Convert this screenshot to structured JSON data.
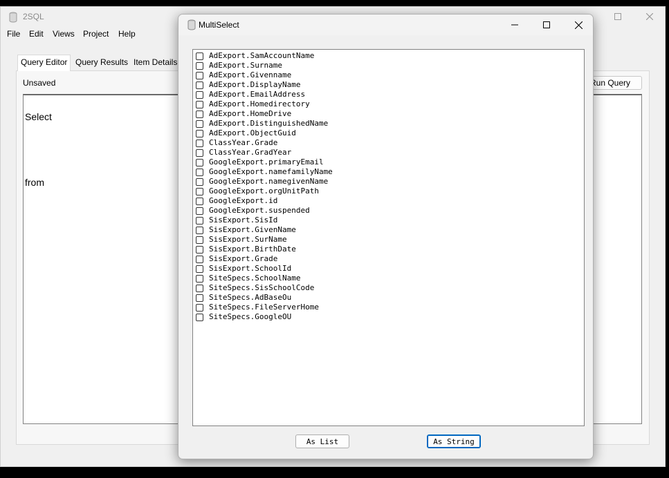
{
  "main_window": {
    "title": "2SQL",
    "app_icon": "database-stack-icon",
    "menu": [
      "File",
      "Edit",
      "Views",
      "Project",
      "Help"
    ],
    "tabs": [
      "Query Editor",
      "Query Results",
      "Item Details"
    ],
    "status_label": "Unsaved",
    "run_button_label": "Run Query",
    "query_lines": [
      "Select",
      "from"
    ]
  },
  "dialog": {
    "title": "MultiSelect",
    "app_icon": "database-stack-icon",
    "fields": [
      {
        "label": "AdExport.SamAccountName",
        "checked": false
      },
      {
        "label": "AdExport.Surname",
        "checked": false
      },
      {
        "label": "AdExport.Givenname",
        "checked": false
      },
      {
        "label": "AdExport.DisplayName",
        "checked": false
      },
      {
        "label": "AdExport.EmailAddress",
        "checked": false
      },
      {
        "label": "AdExport.Homedirectory",
        "checked": false
      },
      {
        "label": "AdExport.HomeDrive",
        "checked": false
      },
      {
        "label": "AdExport.DistinguishedName",
        "checked": false
      },
      {
        "label": "AdExport.ObjectGuid",
        "checked": false
      },
      {
        "label": "ClassYear.Grade",
        "checked": false
      },
      {
        "label": "ClassYear.GradYear",
        "checked": false
      },
      {
        "label": "GoogleExport.primaryEmail",
        "checked": false
      },
      {
        "label": "GoogleExport.namefamilyName",
        "checked": false
      },
      {
        "label": "GoogleExport.namegivenName",
        "checked": false
      },
      {
        "label": "GoogleExport.orgUnitPath",
        "checked": false
      },
      {
        "label": "GoogleExport.id",
        "checked": false
      },
      {
        "label": "GoogleExport.suspended",
        "checked": false
      },
      {
        "label": "SisExport.SisId",
        "checked": false
      },
      {
        "label": "SisExport.GivenName",
        "checked": false
      },
      {
        "label": "SisExport.SurName",
        "checked": false
      },
      {
        "label": "SisExport.BirthDate",
        "checked": false
      },
      {
        "label": "SisExport.Grade",
        "checked": false
      },
      {
        "label": "SisExport.SchoolId",
        "checked": false
      },
      {
        "label": "SiteSpecs.SchoolName",
        "checked": false
      },
      {
        "label": "SiteSpecs.SisSchoolCode",
        "checked": false
      },
      {
        "label": "SiteSpecs.AdBaseOu",
        "checked": false
      },
      {
        "label": "SiteSpecs.FileServerHome",
        "checked": false
      },
      {
        "label": "SiteSpecs.GoogleOU",
        "checked": false
      }
    ],
    "buttons": {
      "as_list": "As List",
      "as_string": "As String"
    }
  },
  "colors": {
    "focus_accent": "#0067c0"
  }
}
